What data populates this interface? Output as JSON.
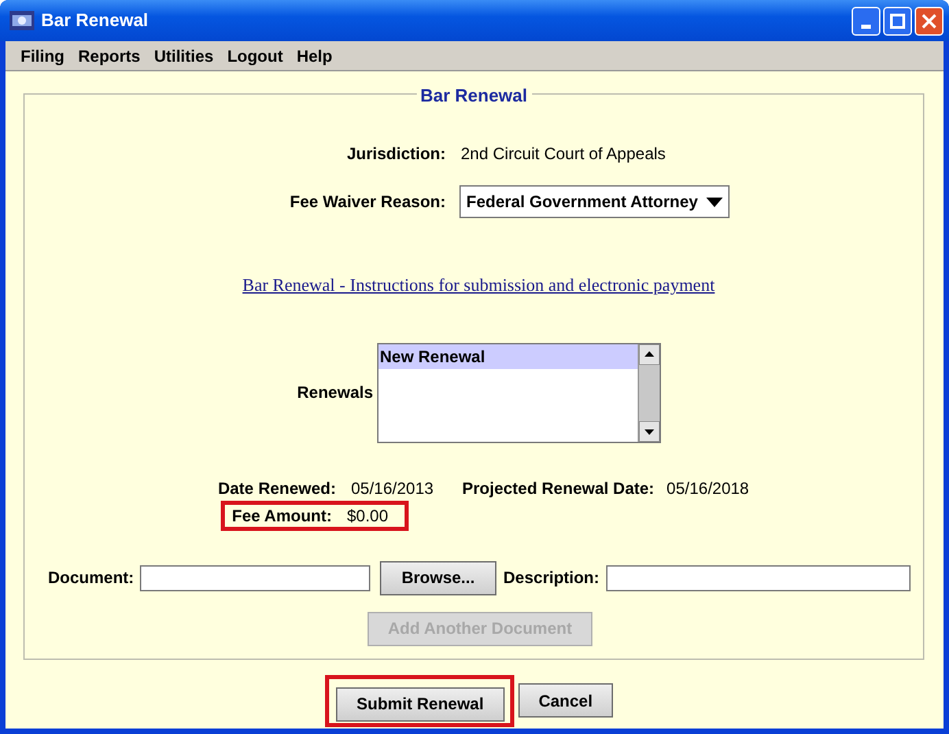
{
  "window": {
    "title": "Bar Renewal"
  },
  "menu": [
    "Filing",
    "Reports",
    "Utilities",
    "Logout",
    "Help"
  ],
  "panel": {
    "title": "Bar Renewal",
    "jurisdiction": {
      "label": "Jurisdiction:",
      "value": "2nd Circuit Court of Appeals"
    },
    "fee_waiver": {
      "label": "Fee Waiver Reason:",
      "value": "Federal Government Attorney"
    },
    "instructions_link": "Bar Renewal - Instructions for submission and electronic payment",
    "renewals": {
      "label": "Renewals",
      "items": [
        {
          "label": "New Renewal",
          "selected": true
        }
      ]
    },
    "date_renewed": {
      "label": "Date Renewed:",
      "value": "05/16/2013"
    },
    "projected_renewal": {
      "label": "Projected Renewal Date:",
      "value": "05/16/2018"
    },
    "fee_amount": {
      "label": "Fee Amount:",
      "value": "$0.00",
      "highlighted": true
    },
    "document": {
      "label": "Document:"
    },
    "browse_button": "Browse...",
    "description": {
      "label": "Description:"
    },
    "add_document_button": {
      "label": "Add Another Document",
      "disabled": true
    }
  },
  "buttons": [
    {
      "label": "Submit Renewal",
      "highlighted": true
    },
    {
      "label": "Cancel",
      "highlighted": false
    }
  ]
}
